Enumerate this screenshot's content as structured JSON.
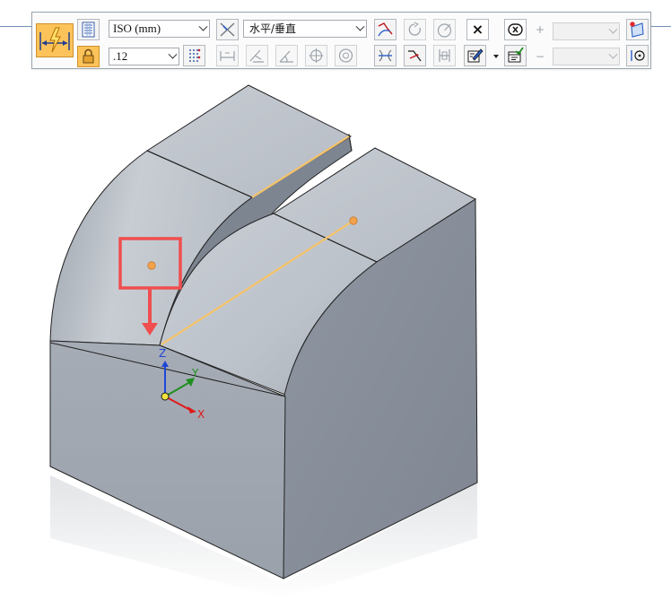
{
  "toolbar": {
    "dimension_style": "ISO (mm)",
    "font_size": ".12",
    "orientation": "水平/垂直",
    "plus_sign": "+",
    "minus_sign": "−",
    "close_symbol": "×",
    "upper_value": "",
    "lower_value": ""
  },
  "axes": {
    "x_label": "X",
    "y_label": "Y",
    "z_label": "Z",
    "x_color": "#e01a1a",
    "y_color": "#1f8f1f",
    "z_color": "#1e46d6"
  },
  "colors": {
    "highlight_box": "#f04e4e",
    "selection_edge": "#f7c368",
    "keypoint": "#f4a24a",
    "icon_active": "#fbc35a"
  },
  "icons": [
    "smart-dimension-icon",
    "dimension-style-table-icon",
    "lock-icon",
    "dimension-axis-icon",
    "decimal-precision-icon",
    "linear-dimension-icon",
    "distance-between-icon",
    "angle-dimension-icon",
    "coordinate-dimension-icon",
    "radius-dimension-icon",
    "diameter-dimension-icon",
    "symmetric-diameter-icon",
    "chamfer-dimension-icon",
    "arc-length-icon",
    "circle-relationship-icon",
    "tangent-circle-icon",
    "clear-icon",
    "edit-annotation-icon",
    "checked-annotation-icon",
    "fixed-value-icon",
    "dimension-plane-icon",
    "point-icon"
  ]
}
